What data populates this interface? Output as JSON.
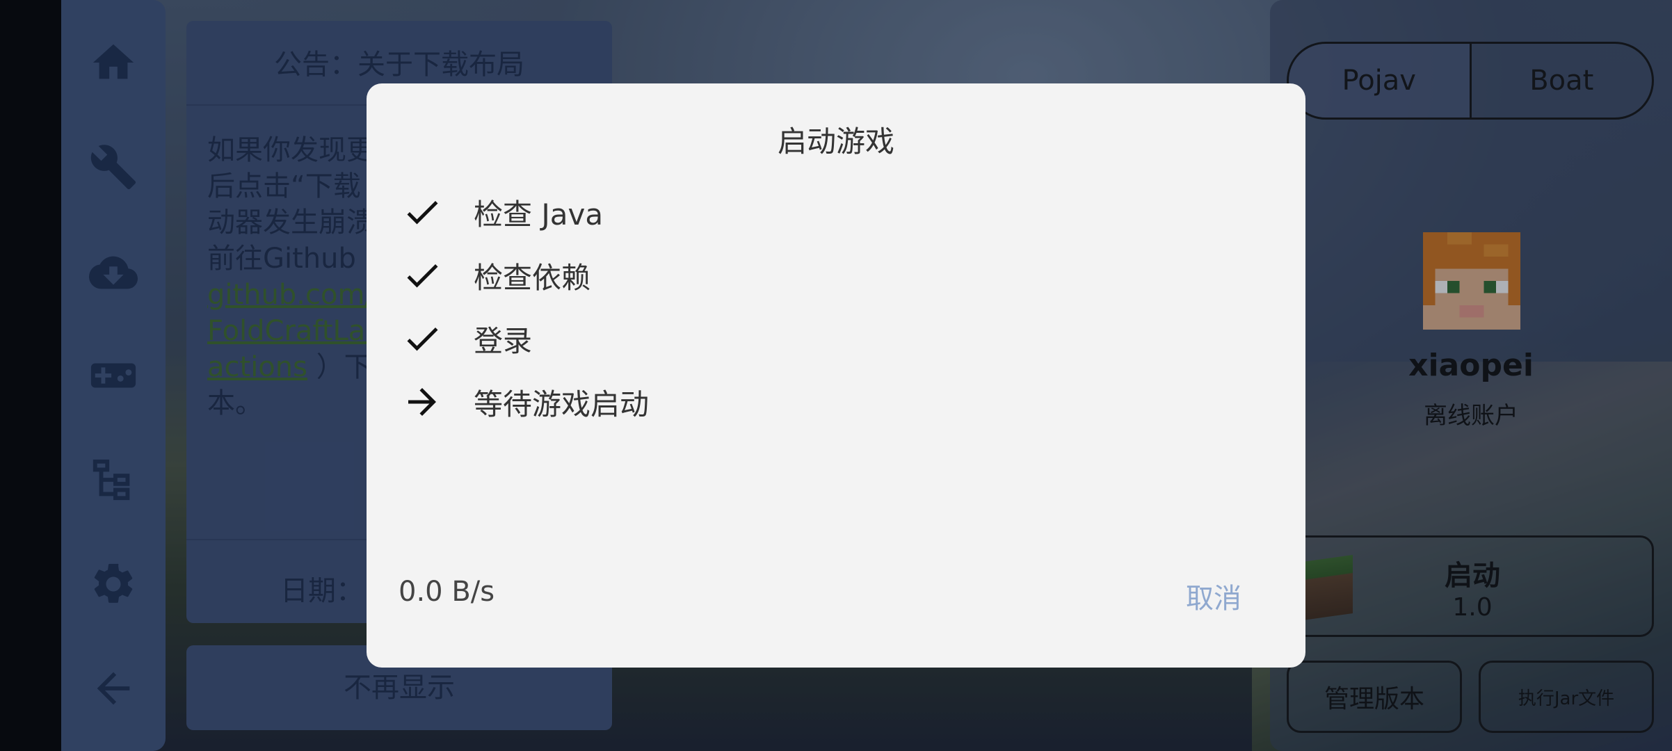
{
  "nav": {
    "items": [
      {
        "icon": "home-icon"
      },
      {
        "icon": "wrench-icon"
      },
      {
        "icon": "cloud-download-icon"
      },
      {
        "icon": "gamepad-icon"
      },
      {
        "icon": "tree-structure-icon"
      },
      {
        "icon": "gear-icon"
      },
      {
        "icon": "back-arrow-icon"
      }
    ]
  },
  "announcement": {
    "title": "公告：关于下载布局",
    "body_lines": [
      "如果你发现更",
      "后点击“下载",
      "动器发生崩溃",
      "前往Github"
    ],
    "link_lines": [
      "github.com/",
      "FoldCraftLau",
      "actions"
    ],
    "after_link": "）下",
    "last_line": "本。",
    "date_label": "日期：",
    "dismiss_label": "不再显示"
  },
  "right_panel": {
    "renderer_tabs": [
      "Pojav",
      "Boat"
    ],
    "username": "xiaopei",
    "account_type": "离线账户",
    "launch_label": "启动",
    "launch_version": "1.0",
    "manage_versions": "管理版本",
    "run_jar": "执行Jar文件"
  },
  "dialog": {
    "title": "启动游戏",
    "steps": [
      {
        "label": "检查 Java",
        "state": "done"
      },
      {
        "label": "检查依赖",
        "state": "done"
      },
      {
        "label": "登录",
        "state": "done"
      },
      {
        "label": "等待游戏启动",
        "state": "in-progress"
      }
    ],
    "speed": "0.0 B/s",
    "cancel_label": "取消"
  },
  "colors": {
    "accent": "#3f557f",
    "dialog_bg": "#f3f3f3",
    "cancel_text": "#8fa8cf"
  }
}
